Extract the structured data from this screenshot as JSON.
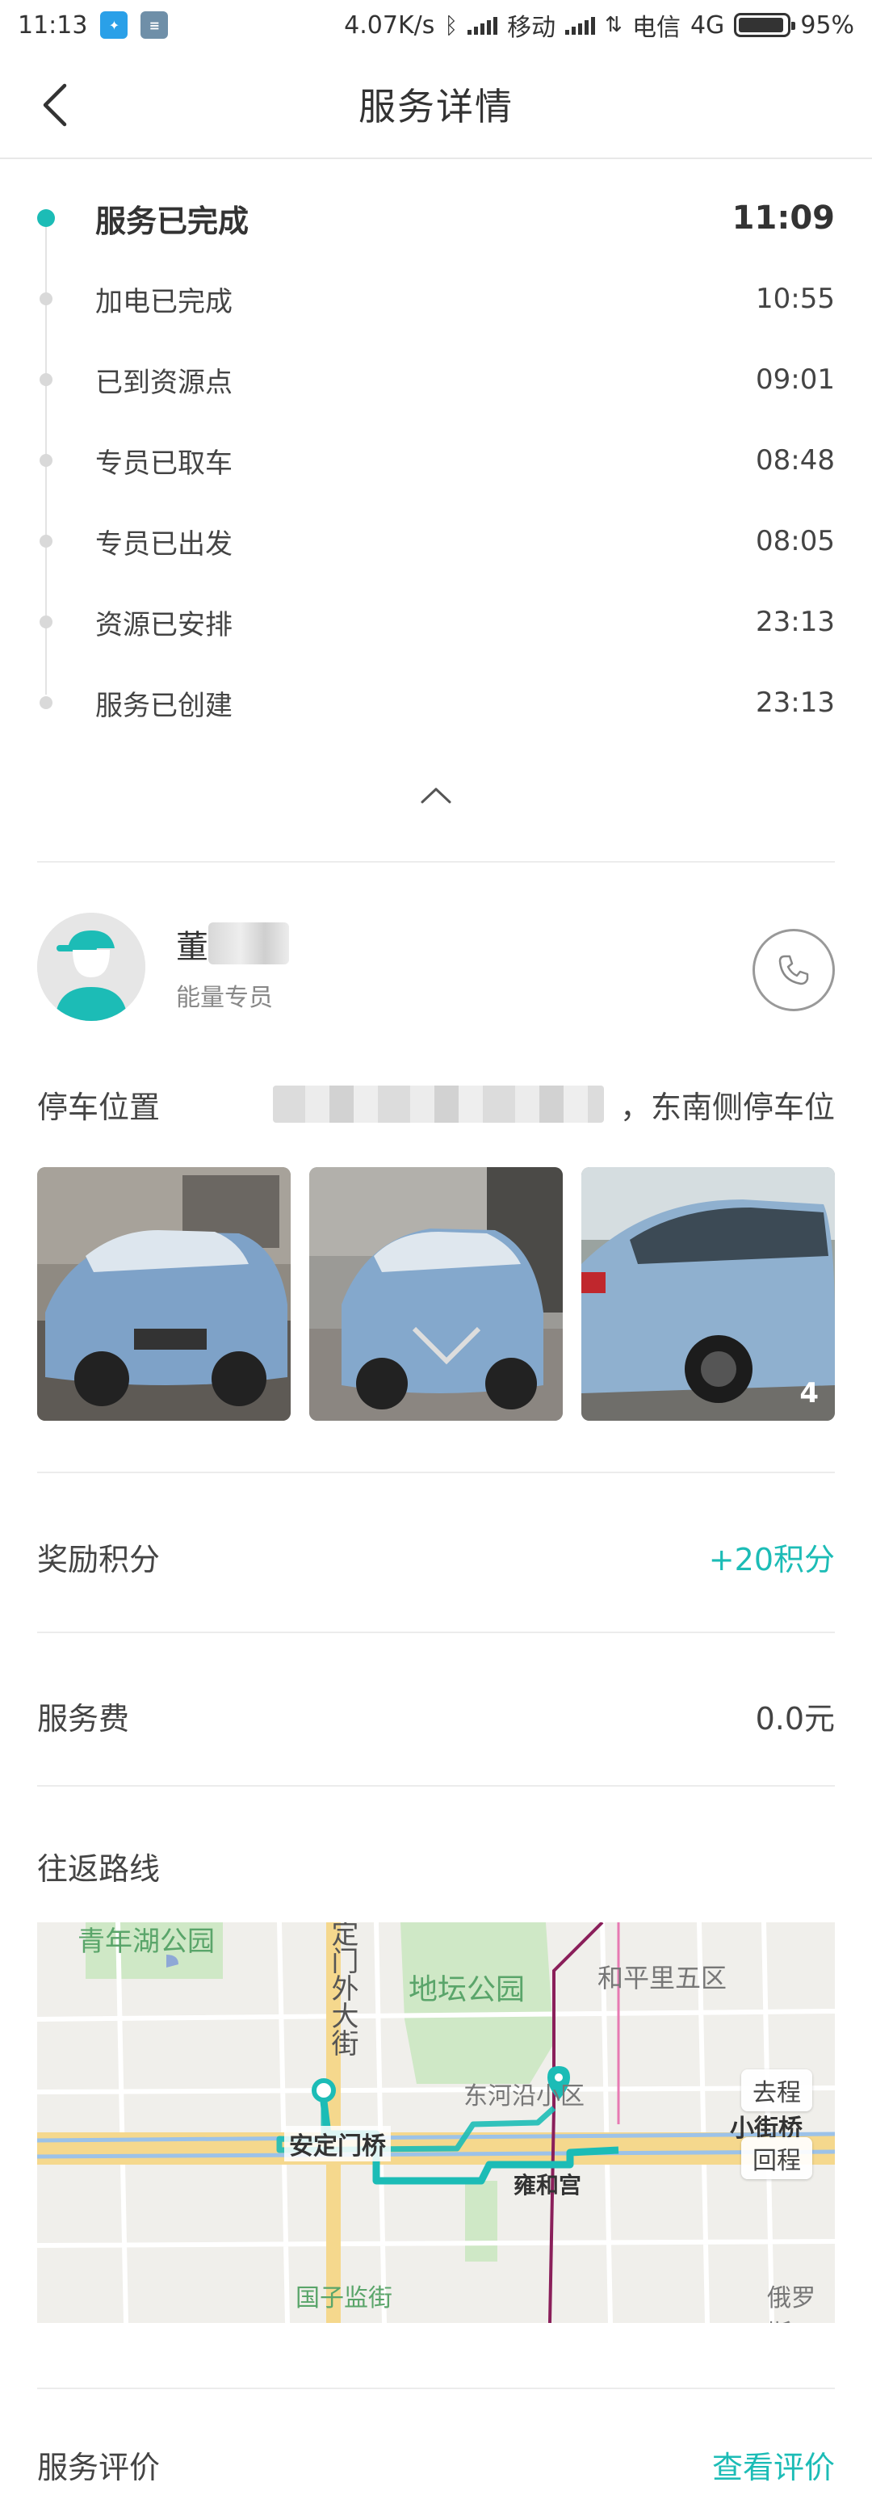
{
  "status_bar": {
    "time": "11:13",
    "network_speed": "4.07K/s",
    "carrier1": "移动",
    "carrier2": "电信",
    "network_type": "4G",
    "battery": "95%",
    "battery_level": 0.95,
    "app_icons": [
      "weibo-icon",
      "calendar-icon"
    ]
  },
  "header": {
    "title": "服务详情"
  },
  "timeline": [
    {
      "label": "服务已完成",
      "time": "11:09",
      "active": true
    },
    {
      "label": "加电已完成",
      "time": "10:55",
      "active": false
    },
    {
      "label": "已到资源点",
      "time": "09:01",
      "active": false
    },
    {
      "label": "专员已取车",
      "time": "08:48",
      "active": false
    },
    {
      "label": "专员已出发",
      "time": "08:05",
      "active": false
    },
    {
      "label": "资源已安排",
      "time": "23:13",
      "active": false
    },
    {
      "label": "服务已创建",
      "time": "23:13",
      "active": false
    }
  ],
  "agent": {
    "name": "董",
    "role": "能量专员"
  },
  "parking": {
    "label": "停车位置",
    "value": "，东南侧停车位"
  },
  "photos": {
    "count": "4"
  },
  "reward": {
    "label": "奖励积分",
    "value": "+20积分"
  },
  "fee": {
    "label": "服务费",
    "value": "0.0元"
  },
  "route": {
    "label": "往返路线",
    "map_labels": {
      "park1": "青年湖公园",
      "street1": "定门外大街",
      "park2": "地坛公园",
      "district1": "和平里五区",
      "district2": "东河沿小区",
      "bridge1": "安定门桥",
      "bridge2": "小街桥",
      "place1": "雍和宫",
      "street2": "国子监街",
      "place2": "俄罗斯"
    },
    "outbound": "去程",
    "return": "回程"
  },
  "review": {
    "label": "服务评价",
    "action": "查看评价"
  },
  "colors": {
    "accent": "#1cbcb6"
  }
}
